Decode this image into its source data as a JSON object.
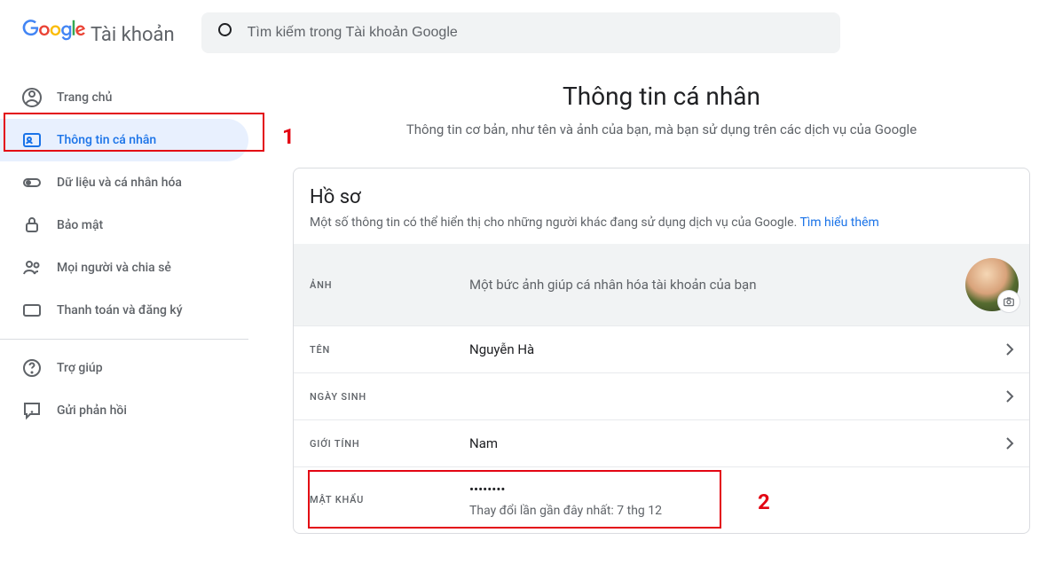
{
  "header": {
    "logo_account": "Tài khoản",
    "search_placeholder": "Tìm kiếm trong Tài khoản Google"
  },
  "sidebar": {
    "items": [
      {
        "label": "Trang chủ",
        "icon": "home"
      },
      {
        "label": "Thông tin cá nhân",
        "icon": "badge",
        "active": true
      },
      {
        "label": "Dữ liệu và cá nhân hóa",
        "icon": "toggle"
      },
      {
        "label": "Bảo mật",
        "icon": "lock"
      },
      {
        "label": "Mọi người và chia sẻ",
        "icon": "people"
      },
      {
        "label": "Thanh toán và đăng ký",
        "icon": "card"
      }
    ],
    "footer": [
      {
        "label": "Trợ giúp",
        "icon": "help"
      },
      {
        "label": "Gửi phản hồi",
        "icon": "feedback"
      }
    ]
  },
  "main": {
    "title": "Thông tin cá nhân",
    "subtitle": "Thông tin cơ bản, như tên và ảnh của bạn, mà bạn sử dụng trên các dịch vụ của Google",
    "profile_card": {
      "heading": "Hồ sơ",
      "desc": "Một số thông tin có thể hiển thị cho những người khác đang sử dụng dịch vụ của Google.",
      "learn_more": "Tìm hiểu thêm",
      "photo_label": "ẢNH",
      "photo_desc": "Một bức ảnh giúp cá nhân hóa tài khoản của bạn",
      "name_label": "TÊN",
      "name_value": "Nguyễn Hà",
      "birthday_label": "NGÀY SINH",
      "birthday_value": "",
      "gender_label": "GIỚI TÍNH",
      "gender_value": "Nam",
      "password_label": "MẬT KHẨU",
      "password_mask": "••••••••",
      "password_sub": "Thay đổi lần gần đây nhất: 7 thg 12"
    }
  },
  "callouts": {
    "one": "1",
    "two": "2"
  }
}
